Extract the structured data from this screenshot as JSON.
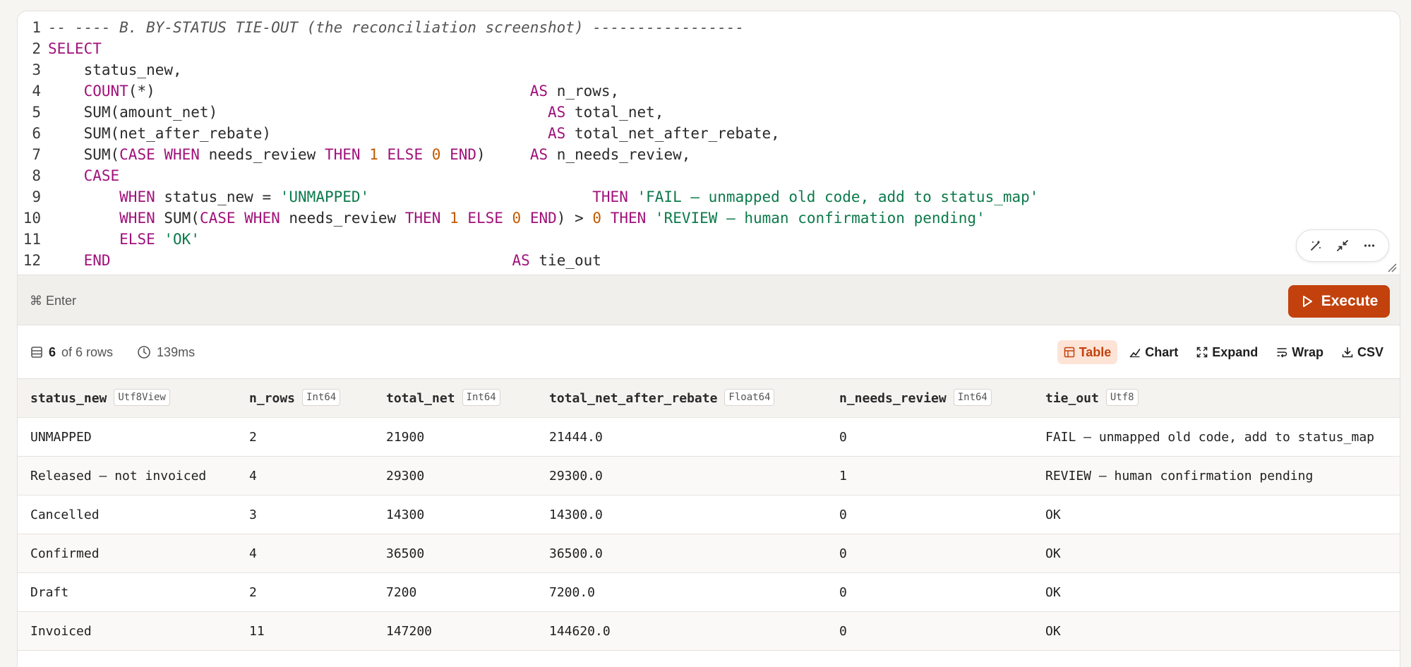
{
  "editor": {
    "lines": [
      [
        {
          "t": "com",
          "v": "-- ---- B. BY-STATUS TIE-OUT (the reconciliation screenshot) -----------------"
        }
      ],
      [
        {
          "t": "kw",
          "v": "SELECT"
        }
      ],
      [
        {
          "t": "plain",
          "v": "    status_new,"
        }
      ],
      [
        {
          "t": "plain",
          "v": "    "
        },
        {
          "t": "kw",
          "v": "COUNT"
        },
        {
          "t": "plain",
          "v": "(*)                                          "
        },
        {
          "t": "kw",
          "v": "AS"
        },
        {
          "t": "plain",
          "v": " n_rows,"
        }
      ],
      [
        {
          "t": "plain",
          "v": "    SUM(amount_net)                                     "
        },
        {
          "t": "kw",
          "v": "AS"
        },
        {
          "t": "plain",
          "v": " total_net,"
        }
      ],
      [
        {
          "t": "plain",
          "v": "    SUM(net_after_rebate)                               "
        },
        {
          "t": "kw",
          "v": "AS"
        },
        {
          "t": "plain",
          "v": " total_net_after_rebate,"
        }
      ],
      [
        {
          "t": "plain",
          "v": "    SUM("
        },
        {
          "t": "kw",
          "v": "CASE WHEN"
        },
        {
          "t": "plain",
          "v": " needs_review "
        },
        {
          "t": "kw",
          "v": "THEN"
        },
        {
          "t": "plain",
          "v": " "
        },
        {
          "t": "num",
          "v": "1"
        },
        {
          "t": "plain",
          "v": " "
        },
        {
          "t": "kw",
          "v": "ELSE"
        },
        {
          "t": "plain",
          "v": " "
        },
        {
          "t": "num",
          "v": "0"
        },
        {
          "t": "plain",
          "v": " "
        },
        {
          "t": "kw",
          "v": "END"
        },
        {
          "t": "plain",
          "v": ")     "
        },
        {
          "t": "kw",
          "v": "AS"
        },
        {
          "t": "plain",
          "v": " n_needs_review,"
        }
      ],
      [
        {
          "t": "plain",
          "v": "    "
        },
        {
          "t": "kw",
          "v": "CASE"
        }
      ],
      [
        {
          "t": "plain",
          "v": "        "
        },
        {
          "t": "kw",
          "v": "WHEN"
        },
        {
          "t": "plain",
          "v": " status_new = "
        },
        {
          "t": "str",
          "v": "'UNMAPPED'"
        },
        {
          "t": "plain",
          "v": "                         "
        },
        {
          "t": "kw",
          "v": "THEN"
        },
        {
          "t": "plain",
          "v": " "
        },
        {
          "t": "str",
          "v": "'FAIL — unmapped old code, add to status_map'"
        }
      ],
      [
        {
          "t": "plain",
          "v": "        "
        },
        {
          "t": "kw",
          "v": "WHEN"
        },
        {
          "t": "plain",
          "v": " SUM("
        },
        {
          "t": "kw",
          "v": "CASE WHEN"
        },
        {
          "t": "plain",
          "v": " needs_review "
        },
        {
          "t": "kw",
          "v": "THEN"
        },
        {
          "t": "plain",
          "v": " "
        },
        {
          "t": "num",
          "v": "1"
        },
        {
          "t": "plain",
          "v": " "
        },
        {
          "t": "kw",
          "v": "ELSE"
        },
        {
          "t": "plain",
          "v": " "
        },
        {
          "t": "num",
          "v": "0"
        },
        {
          "t": "plain",
          "v": " "
        },
        {
          "t": "kw",
          "v": "END"
        },
        {
          "t": "plain",
          "v": ") > "
        },
        {
          "t": "num",
          "v": "0"
        },
        {
          "t": "plain",
          "v": " "
        },
        {
          "t": "kw",
          "v": "THEN"
        },
        {
          "t": "plain",
          "v": " "
        },
        {
          "t": "str",
          "v": "'REVIEW — human confirmation pending'"
        }
      ],
      [
        {
          "t": "plain",
          "v": "        "
        },
        {
          "t": "kw",
          "v": "ELSE"
        },
        {
          "t": "plain",
          "v": " "
        },
        {
          "t": "str",
          "v": "'OK'"
        }
      ],
      [
        {
          "t": "plain",
          "v": "    "
        },
        {
          "t": "kw",
          "v": "END"
        },
        {
          "t": "plain",
          "v": "                                             "
        },
        {
          "t": "kw",
          "v": "AS"
        },
        {
          "t": "plain",
          "v": " tie_out"
        }
      ]
    ]
  },
  "editor_tools": {
    "icons": [
      "magic-wand-icon",
      "collapse-icon",
      "more-icon"
    ]
  },
  "runbar": {
    "shortcut": "⌘ Enter",
    "execute_label": "Execute"
  },
  "result": {
    "row_count": "6",
    "row_total": "of 6 rows",
    "duration": "139ms",
    "tools": {
      "table": "Table",
      "chart": "Chart",
      "expand": "Expand",
      "wrap": "Wrap",
      "csv": "CSV"
    }
  },
  "table": {
    "columns": [
      {
        "name": "status_new",
        "type": "Utf8View"
      },
      {
        "name": "n_rows",
        "type": "Int64"
      },
      {
        "name": "total_net",
        "type": "Int64"
      },
      {
        "name": "total_net_after_rebate",
        "type": "Float64"
      },
      {
        "name": "n_needs_review",
        "type": "Int64"
      },
      {
        "name": "tie_out",
        "type": "Utf8"
      }
    ],
    "rows": [
      [
        "UNMAPPED",
        "2",
        "21900",
        "21444.0",
        "0",
        "FAIL — unmapped old code, add to status_map"
      ],
      [
        "Released — not invoiced",
        "4",
        "29300",
        "29300.0",
        "1",
        "REVIEW — human confirmation pending"
      ],
      [
        "Cancelled",
        "3",
        "14300",
        "14300.0",
        "0",
        "OK"
      ],
      [
        "Confirmed",
        "4",
        "36500",
        "36500.0",
        "0",
        "OK"
      ],
      [
        "Draft",
        "2",
        "7200",
        "7200.0",
        "0",
        "OK"
      ],
      [
        "Invoiced",
        "11",
        "147200",
        "144620.0",
        "0",
        "OK"
      ]
    ]
  },
  "colors": {
    "accent": "#c2410c",
    "keyword": "#a0117a",
    "string": "#0c7a4a",
    "number": "#c05a00"
  }
}
